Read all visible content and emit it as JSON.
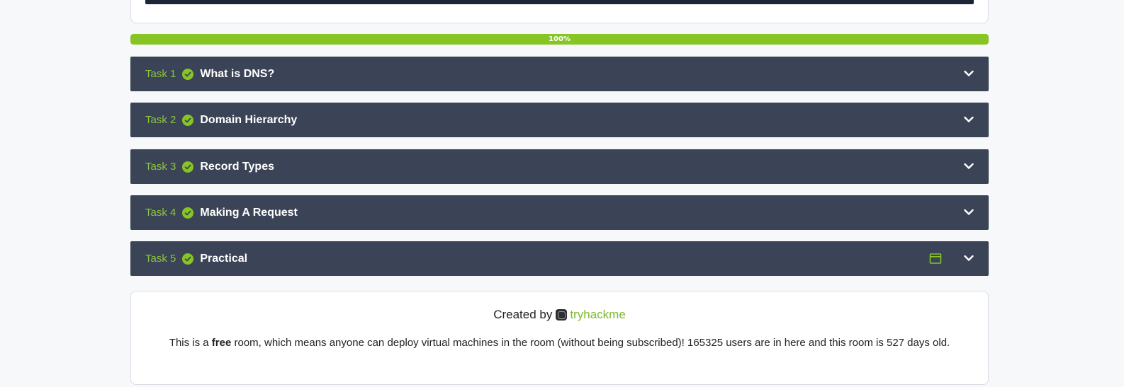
{
  "progress": {
    "percent_label": "100%",
    "value": 1.0
  },
  "tasks": [
    {
      "number_label": "Task 1",
      "title": "What is DNS?",
      "has_window_icon": false
    },
    {
      "number_label": "Task 2",
      "title": "Domain Hierarchy",
      "has_window_icon": false
    },
    {
      "number_label": "Task 3",
      "title": "Record Types",
      "has_window_icon": false
    },
    {
      "number_label": "Task 4",
      "title": "Making A Request",
      "has_window_icon": false
    },
    {
      "number_label": "Task 5",
      "title": "Practical",
      "has_window_icon": true
    }
  ],
  "footer": {
    "created_by_label": "Created by",
    "creator_name": "tryhackme",
    "desc_before": "This is a ",
    "desc_emphasis": "free",
    "desc_after": " room, which means anyone can deploy virtual machines in the room (without being subscribed)! 165325 users are in here and this room is 527 days old."
  },
  "colors": {
    "accent_green": "#87c524",
    "task_bg": "#3b4357",
    "page_bg": "#f7f8f9"
  },
  "icons": {
    "check": "check-circle-icon",
    "chevron": "chevron-down-icon",
    "window": "window-icon",
    "avatar": "tryhackme-avatar"
  }
}
